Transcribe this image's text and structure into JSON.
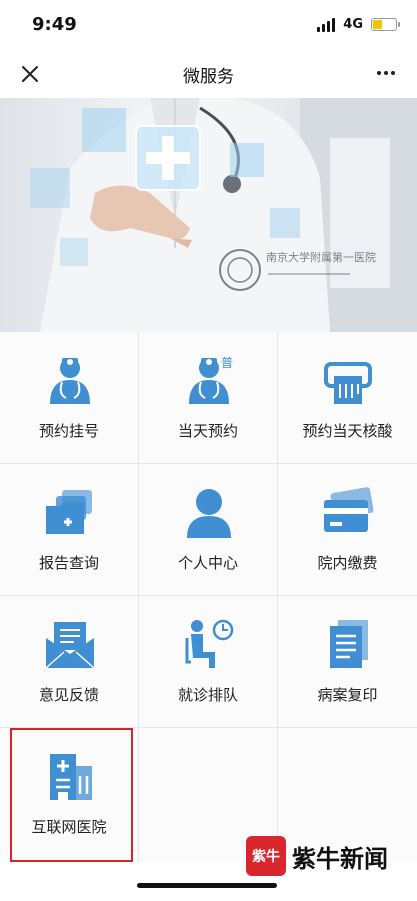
{
  "status": {
    "time": "9:49",
    "network": "4G",
    "battery_level": 0.45
  },
  "nav": {
    "title": "微服务",
    "close_icon": "close-icon",
    "more_icon": "more-icon"
  },
  "banner": {
    "hospital_seal_text": "南京大学附属第一医院"
  },
  "menu": [
    {
      "label": "预约挂号",
      "icon": "doctor-icon"
    },
    {
      "label": "当天预约",
      "icon": "doctor-general-icon",
      "badge": "普"
    },
    {
      "label": "预约当天核酸",
      "icon": "printer-icon"
    },
    {
      "label": "报告查询",
      "icon": "folders-icon"
    },
    {
      "label": "个人中心",
      "icon": "person-icon"
    },
    {
      "label": "院内缴费",
      "icon": "card-icon"
    },
    {
      "label": "意见反馈",
      "icon": "mail-icon"
    },
    {
      "label": "就诊排队",
      "icon": "queue-icon"
    },
    {
      "label": "病案复印",
      "icon": "documents-icon"
    },
    {
      "label": "互联网医院",
      "icon": "hospital-icon"
    }
  ],
  "watermark": {
    "logo_text": "紫牛",
    "text": "紫牛新闻"
  },
  "colors": {
    "icon_blue": "#3f8fd2",
    "highlight_red": "#d0262b"
  }
}
